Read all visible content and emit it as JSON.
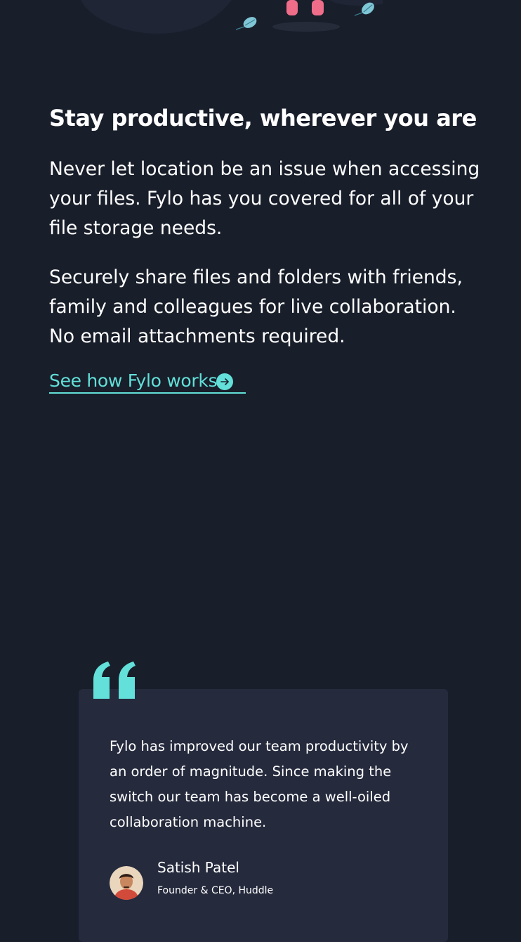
{
  "productive": {
    "heading": "Stay productive, wherever you are",
    "paragraph_1": "Never let location be an issue when accessing your files. Fylo has you covered for all of your file storage needs.",
    "paragraph_2": "Securely share files and folders with friends, family and colleagues for live collaboration. No email attachments required.",
    "link_label": "See how Fylo works",
    "link_icon": "arrow-circle-right-icon"
  },
  "testimonial": {
    "quote_icon": "quotes-icon",
    "text": "Fylo has improved our team productivity by an order of magnitude. Since making the switch our team has become a well-oiled collaboration machine.",
    "name": "Satish Patel",
    "role": "Founder & CEO, Huddle",
    "avatar_icon": "avatar-photo"
  },
  "colors": {
    "background": "#181e2a",
    "card_background": "#252a3d",
    "accent": "#62e0d9",
    "text": "#ffffff"
  }
}
